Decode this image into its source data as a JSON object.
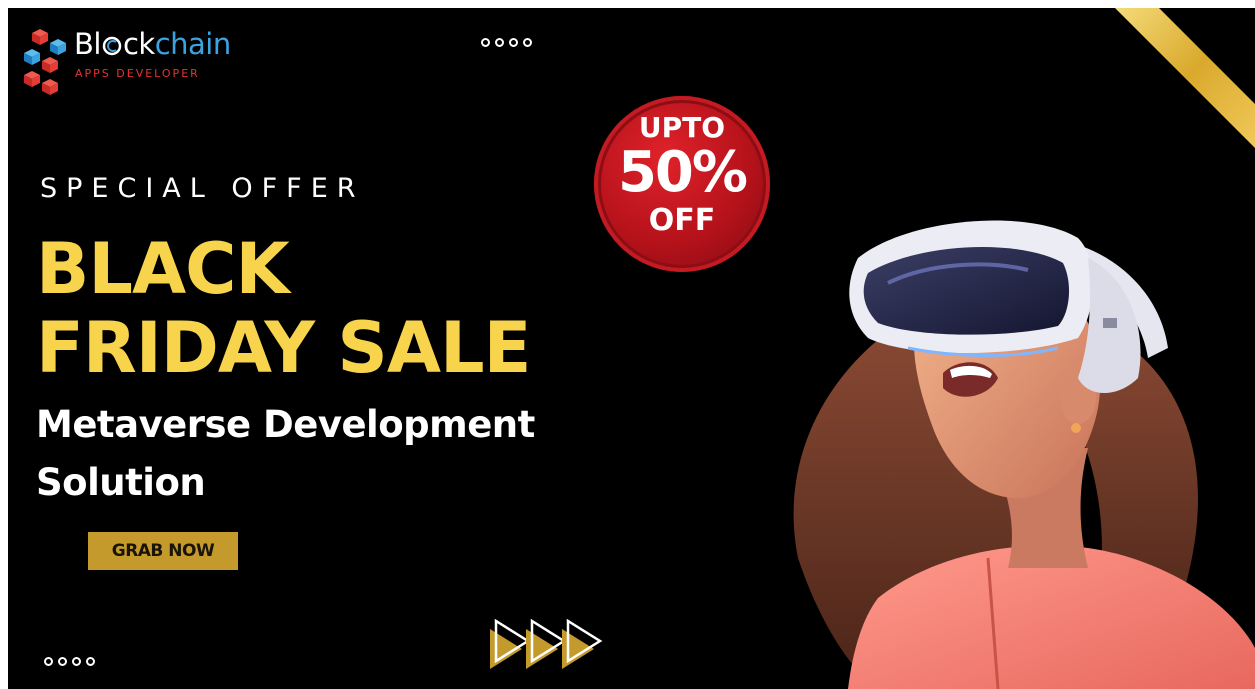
{
  "logo": {
    "word_part1": "Bl",
    "word_part2": "ck",
    "word_part3": "chain",
    "subtitle": "APPS DEVELOPER"
  },
  "banner": {
    "eyebrow": "SPECIAL OFFER",
    "headline_line1": "BLACK",
    "headline_line2": "FRIDAY SALE",
    "sub_line1": "Metaverse Development",
    "sub_line2": "Solution",
    "cta_label": "GRAB NOW"
  },
  "badge": {
    "line1": "UPTO",
    "line2": "50%",
    "line3": "OFF"
  },
  "colors": {
    "background": "#000000",
    "headline": "#f7d44c",
    "cta": "#c49a2c",
    "badge_red": "#c41a22",
    "ribbon_gold": "#e2b93b",
    "logo_blue": "#3aa3e0",
    "logo_red": "#e8332f"
  },
  "icons": [
    "cube-logo-icon",
    "c-emblem-icon",
    "dots-decoration-icon",
    "gold-ribbon-icon",
    "play-arrows-icon",
    "vr-girl-illustration"
  ]
}
